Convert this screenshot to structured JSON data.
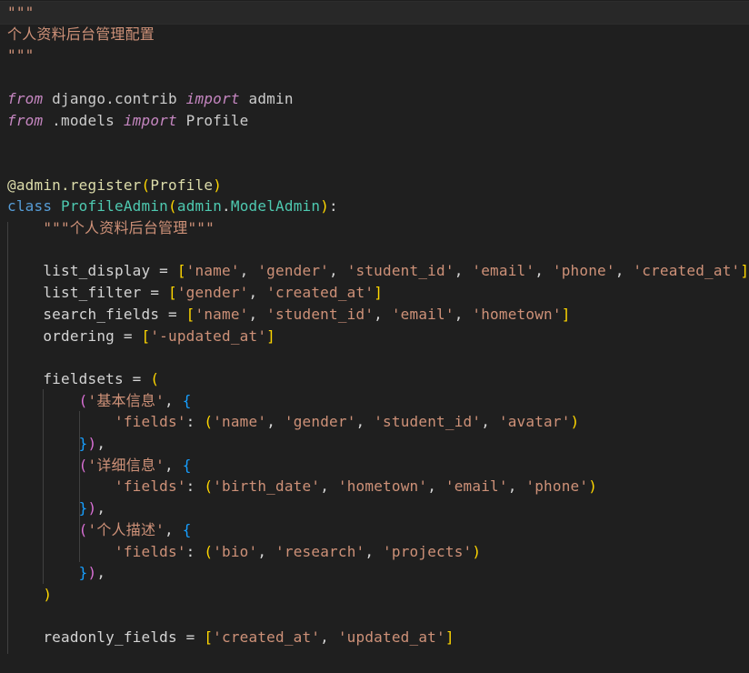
{
  "editor": {
    "language": "python",
    "colors": {
      "background": "#1f1f1f",
      "string": "#ce9178",
      "keyword": "#c586c0",
      "class_keyword": "#569cd6",
      "class_name": "#4ec9b0",
      "decorator": "#dcdcaa",
      "variable": "#9cdcfe",
      "bracket_gold": "#ffd700",
      "bracket_orchid": "#da70d6",
      "bracket_blue": "#179fff"
    },
    "lines": [
      [
        {
          "t": "\"\"\"",
          "c": "tok-docstring"
        }
      ],
      [
        {
          "t": "个人资料后台管理配置",
          "c": "tok-docstring-cjk"
        }
      ],
      [
        {
          "t": "\"\"\"",
          "c": "tok-docstring"
        }
      ],
      [],
      [
        {
          "t": "from",
          "c": "tok-keyword"
        },
        {
          "t": " django.contrib ",
          "c": "tok-module"
        },
        {
          "t": "import",
          "c": "tok-keyword"
        },
        {
          "t": " admin",
          "c": "tok-module"
        }
      ],
      [
        {
          "t": "from",
          "c": "tok-keyword"
        },
        {
          "t": " .models ",
          "c": "tok-module"
        },
        {
          "t": "import",
          "c": "tok-keyword"
        },
        {
          "t": " Profile",
          "c": "tok-module"
        }
      ],
      [],
      [],
      [
        {
          "t": "@admin.register",
          "c": "tok-decorator"
        },
        {
          "t": "(",
          "c": "tok-bracket1"
        },
        {
          "t": "Profile",
          "c": "tok-decorator"
        },
        {
          "t": ")",
          "c": "tok-bracket1"
        }
      ],
      [
        {
          "t": "class",
          "c": "tok-class"
        },
        {
          "t": " ",
          "c": "tok-plain"
        },
        {
          "t": "ProfileAdmin",
          "c": "tok-classname"
        },
        {
          "t": "(",
          "c": "tok-bracket1"
        },
        {
          "t": "admin",
          "c": "tok-classname"
        },
        {
          "t": ".",
          "c": "tok-plain"
        },
        {
          "t": "ModelAdmin",
          "c": "tok-classname"
        },
        {
          "t": ")",
          "c": "tok-bracket1"
        },
        {
          "t": ":",
          "c": "tok-plain"
        }
      ],
      [
        {
          "t": "    ",
          "c": "tok-plain"
        },
        {
          "t": "\"\"\"",
          "c": "tok-docstring"
        },
        {
          "t": "个人资料后台管理",
          "c": "tok-docstring-cjk"
        },
        {
          "t": "\"\"\"",
          "c": "tok-docstring"
        }
      ],
      [],
      [
        {
          "t": "    list_display = ",
          "c": "tok-plain"
        },
        {
          "t": "[",
          "c": "tok-bracket1"
        },
        {
          "t": "'name'",
          "c": "tok-string"
        },
        {
          "t": ", ",
          "c": "tok-plain"
        },
        {
          "t": "'gender'",
          "c": "tok-string"
        },
        {
          "t": ", ",
          "c": "tok-plain"
        },
        {
          "t": "'student_id'",
          "c": "tok-string"
        },
        {
          "t": ", ",
          "c": "tok-plain"
        },
        {
          "t": "'email'",
          "c": "tok-string"
        },
        {
          "t": ", ",
          "c": "tok-plain"
        },
        {
          "t": "'phone'",
          "c": "tok-string"
        },
        {
          "t": ", ",
          "c": "tok-plain"
        },
        {
          "t": "'created_at'",
          "c": "tok-string"
        },
        {
          "t": "]",
          "c": "tok-bracket1"
        }
      ],
      [
        {
          "t": "    list_filter = ",
          "c": "tok-plain"
        },
        {
          "t": "[",
          "c": "tok-bracket1"
        },
        {
          "t": "'gender'",
          "c": "tok-string"
        },
        {
          "t": ", ",
          "c": "tok-plain"
        },
        {
          "t": "'created_at'",
          "c": "tok-string"
        },
        {
          "t": "]",
          "c": "tok-bracket1"
        }
      ],
      [
        {
          "t": "    search_fields = ",
          "c": "tok-plain"
        },
        {
          "t": "[",
          "c": "tok-bracket1"
        },
        {
          "t": "'name'",
          "c": "tok-string"
        },
        {
          "t": ", ",
          "c": "tok-plain"
        },
        {
          "t": "'student_id'",
          "c": "tok-string"
        },
        {
          "t": ", ",
          "c": "tok-plain"
        },
        {
          "t": "'email'",
          "c": "tok-string"
        },
        {
          "t": ", ",
          "c": "tok-plain"
        },
        {
          "t": "'hometown'",
          "c": "tok-string"
        },
        {
          "t": "]",
          "c": "tok-bracket1"
        }
      ],
      [
        {
          "t": "    ordering = ",
          "c": "tok-plain"
        },
        {
          "t": "[",
          "c": "tok-bracket1"
        },
        {
          "t": "'-updated_at'",
          "c": "tok-string"
        },
        {
          "t": "]",
          "c": "tok-bracket1"
        }
      ],
      [],
      [
        {
          "t": "    fieldsets = ",
          "c": "tok-plain"
        },
        {
          "t": "(",
          "c": "tok-bracket1"
        }
      ],
      [
        {
          "t": "        ",
          "c": "tok-plain"
        },
        {
          "t": "(",
          "c": "tok-bracket2"
        },
        {
          "t": "'",
          "c": "tok-string"
        },
        {
          "t": "基本信息",
          "c": "tok-cjk"
        },
        {
          "t": "'",
          "c": "tok-string"
        },
        {
          "t": ", ",
          "c": "tok-plain"
        },
        {
          "t": "{",
          "c": "tok-bracket3"
        }
      ],
      [
        {
          "t": "            ",
          "c": "tok-plain"
        },
        {
          "t": "'fields'",
          "c": "tok-string"
        },
        {
          "t": ": ",
          "c": "tok-plain"
        },
        {
          "t": "(",
          "c": "tok-bracket1"
        },
        {
          "t": "'name'",
          "c": "tok-string"
        },
        {
          "t": ", ",
          "c": "tok-plain"
        },
        {
          "t": "'gender'",
          "c": "tok-string"
        },
        {
          "t": ", ",
          "c": "tok-plain"
        },
        {
          "t": "'student_id'",
          "c": "tok-string"
        },
        {
          "t": ", ",
          "c": "tok-plain"
        },
        {
          "t": "'avatar'",
          "c": "tok-string"
        },
        {
          "t": ")",
          "c": "tok-bracket1"
        }
      ],
      [
        {
          "t": "        ",
          "c": "tok-plain"
        },
        {
          "t": "}",
          "c": "tok-bracket3"
        },
        {
          "t": ")",
          "c": "tok-bracket2"
        },
        {
          "t": ",",
          "c": "tok-plain"
        }
      ],
      [
        {
          "t": "        ",
          "c": "tok-plain"
        },
        {
          "t": "(",
          "c": "tok-bracket2"
        },
        {
          "t": "'",
          "c": "tok-string"
        },
        {
          "t": "详细信息",
          "c": "tok-cjk"
        },
        {
          "t": "'",
          "c": "tok-string"
        },
        {
          "t": ", ",
          "c": "tok-plain"
        },
        {
          "t": "{",
          "c": "tok-bracket3"
        }
      ],
      [
        {
          "t": "            ",
          "c": "tok-plain"
        },
        {
          "t": "'fields'",
          "c": "tok-string"
        },
        {
          "t": ": ",
          "c": "tok-plain"
        },
        {
          "t": "(",
          "c": "tok-bracket1"
        },
        {
          "t": "'birth_date'",
          "c": "tok-string"
        },
        {
          "t": ", ",
          "c": "tok-plain"
        },
        {
          "t": "'hometown'",
          "c": "tok-string"
        },
        {
          "t": ", ",
          "c": "tok-plain"
        },
        {
          "t": "'email'",
          "c": "tok-string"
        },
        {
          "t": ", ",
          "c": "tok-plain"
        },
        {
          "t": "'phone'",
          "c": "tok-string"
        },
        {
          "t": ")",
          "c": "tok-bracket1"
        }
      ],
      [
        {
          "t": "        ",
          "c": "tok-plain"
        },
        {
          "t": "}",
          "c": "tok-bracket3"
        },
        {
          "t": ")",
          "c": "tok-bracket2"
        },
        {
          "t": ",",
          "c": "tok-plain"
        }
      ],
      [
        {
          "t": "        ",
          "c": "tok-plain"
        },
        {
          "t": "(",
          "c": "tok-bracket2"
        },
        {
          "t": "'",
          "c": "tok-string"
        },
        {
          "t": "个人描述",
          "c": "tok-cjk"
        },
        {
          "t": "'",
          "c": "tok-string"
        },
        {
          "t": ", ",
          "c": "tok-plain"
        },
        {
          "t": "{",
          "c": "tok-bracket3"
        }
      ],
      [
        {
          "t": "            ",
          "c": "tok-plain"
        },
        {
          "t": "'fields'",
          "c": "tok-string"
        },
        {
          "t": ": ",
          "c": "tok-plain"
        },
        {
          "t": "(",
          "c": "tok-bracket1"
        },
        {
          "t": "'bio'",
          "c": "tok-string"
        },
        {
          "t": ", ",
          "c": "tok-plain"
        },
        {
          "t": "'research'",
          "c": "tok-string"
        },
        {
          "t": ", ",
          "c": "tok-plain"
        },
        {
          "t": "'projects'",
          "c": "tok-string"
        },
        {
          "t": ")",
          "c": "tok-bracket1"
        }
      ],
      [
        {
          "t": "        ",
          "c": "tok-plain"
        },
        {
          "t": "}",
          "c": "tok-bracket3"
        },
        {
          "t": ")",
          "c": "tok-bracket2"
        },
        {
          "t": ",",
          "c": "tok-plain"
        }
      ],
      [
        {
          "t": "    ",
          "c": "tok-plain"
        },
        {
          "t": ")",
          "c": "tok-bracket1"
        }
      ],
      [],
      [
        {
          "t": "    readonly_fields = ",
          "c": "tok-plain"
        },
        {
          "t": "[",
          "c": "tok-bracket1"
        },
        {
          "t": "'created_at'",
          "c": "tok-string"
        },
        {
          "t": ", ",
          "c": "tok-plain"
        },
        {
          "t": "'updated_at'",
          "c": "tok-string"
        },
        {
          "t": "]",
          "c": "tok-bracket1"
        }
      ]
    ]
  }
}
